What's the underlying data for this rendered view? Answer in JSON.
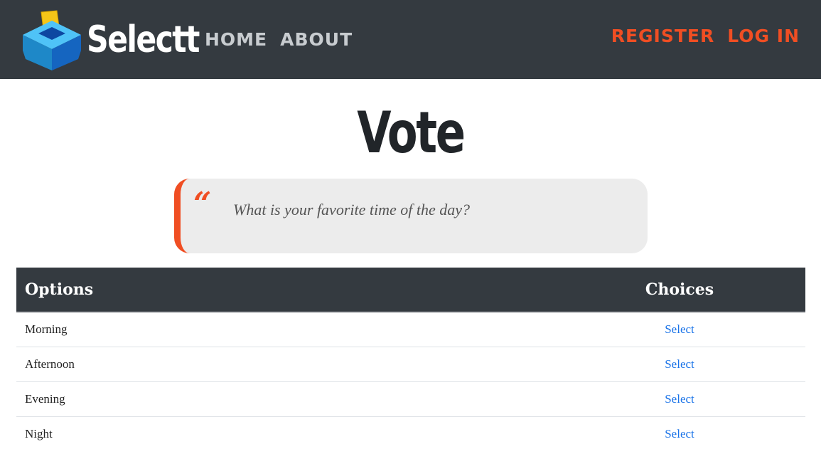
{
  "nav": {
    "brand": "Selectt",
    "links": [
      "HOME",
      "ABOUT"
    ],
    "auth": [
      "REGISTER",
      "LOG IN"
    ]
  },
  "page": {
    "title": "Vote"
  },
  "question": "What is your favorite time of the day?",
  "table": {
    "headers": {
      "options": "Options",
      "choices": "Choices"
    },
    "rows": [
      {
        "option": "Morning",
        "action": "Select"
      },
      {
        "option": "Afternoon",
        "action": "Select"
      },
      {
        "option": "Evening",
        "action": "Select"
      },
      {
        "option": "Night",
        "action": "Select"
      }
    ]
  },
  "colors": {
    "navbar": "#343a40",
    "accent": "#f04e23",
    "link": "#1a73e8",
    "quote_bg": "#ececec"
  },
  "icons": {
    "logo": "ballot-box-icon",
    "quote": "quote-icon"
  }
}
